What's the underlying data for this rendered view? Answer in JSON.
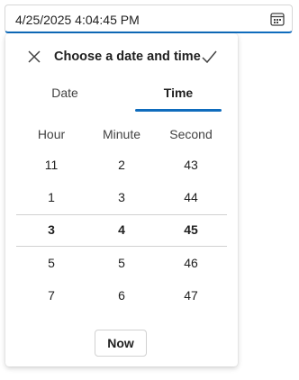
{
  "field": {
    "value": "4/25/2025 4:04:45 PM",
    "icon": "calendar-icon"
  },
  "header": {
    "title": "Choose a date and time",
    "close_icon": "close-icon",
    "confirm_icon": "checkmark-icon"
  },
  "tabs": [
    {
      "label": "Date",
      "selected": false
    },
    {
      "label": "Time",
      "selected": true
    }
  ],
  "columns": [
    "Hour",
    "Minute",
    "Second"
  ],
  "rows": [
    {
      "hour": "11",
      "minute": "2",
      "second": "43",
      "selected": false
    },
    {
      "hour": "1",
      "minute": "3",
      "second": "44",
      "selected": false
    },
    {
      "hour": "3",
      "minute": "4",
      "second": "45",
      "selected": true
    },
    {
      "hour": "5",
      "minute": "5",
      "second": "46",
      "selected": false
    },
    {
      "hour": "7",
      "minute": "6",
      "second": "47",
      "selected": false
    }
  ],
  "now_label": "Now",
  "colors": {
    "accent": "#0f6cbd",
    "divider": "#d1d1d1"
  }
}
